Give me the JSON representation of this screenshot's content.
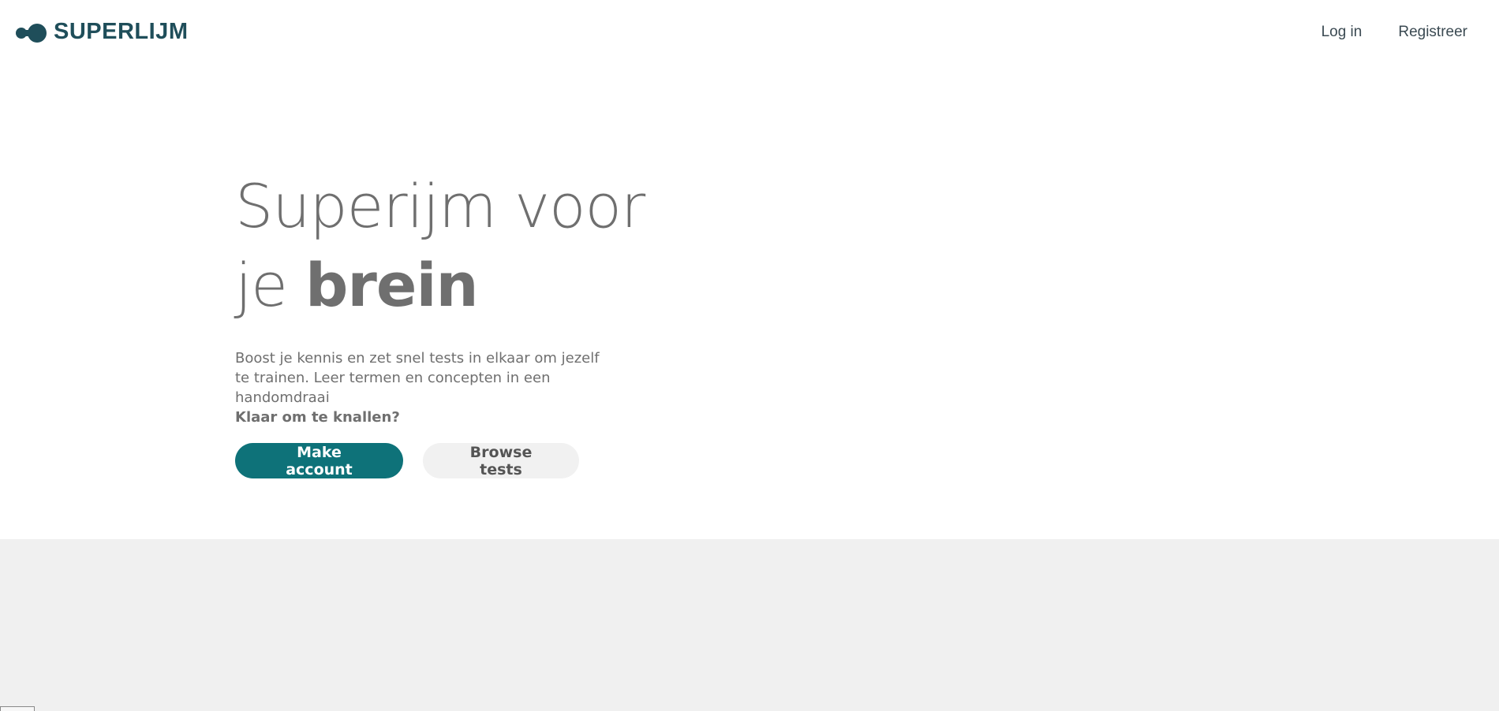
{
  "brand": {
    "name": "SUPERLIJM",
    "color": "#1f4e5a"
  },
  "nav": {
    "login": "Log in",
    "register": "Registreer"
  },
  "hero": {
    "title_line1": "Superijm voor",
    "title_line2_light": "je ",
    "title_line2_bold": "brein",
    "subtitle": "Boost je kennis en zet snel tests in elkaar om jezelf te trainen. Leer termen en concepten in een handomdraai",
    "cta_text": "Klaar om te knallen?",
    "primary_button": "Make account",
    "secondary_button": "Browse tests"
  },
  "colors": {
    "primary": "#0e7279",
    "secondary_bg": "#f1f1f1",
    "text": "#6f6f6f",
    "band": "#f0f0f0"
  }
}
